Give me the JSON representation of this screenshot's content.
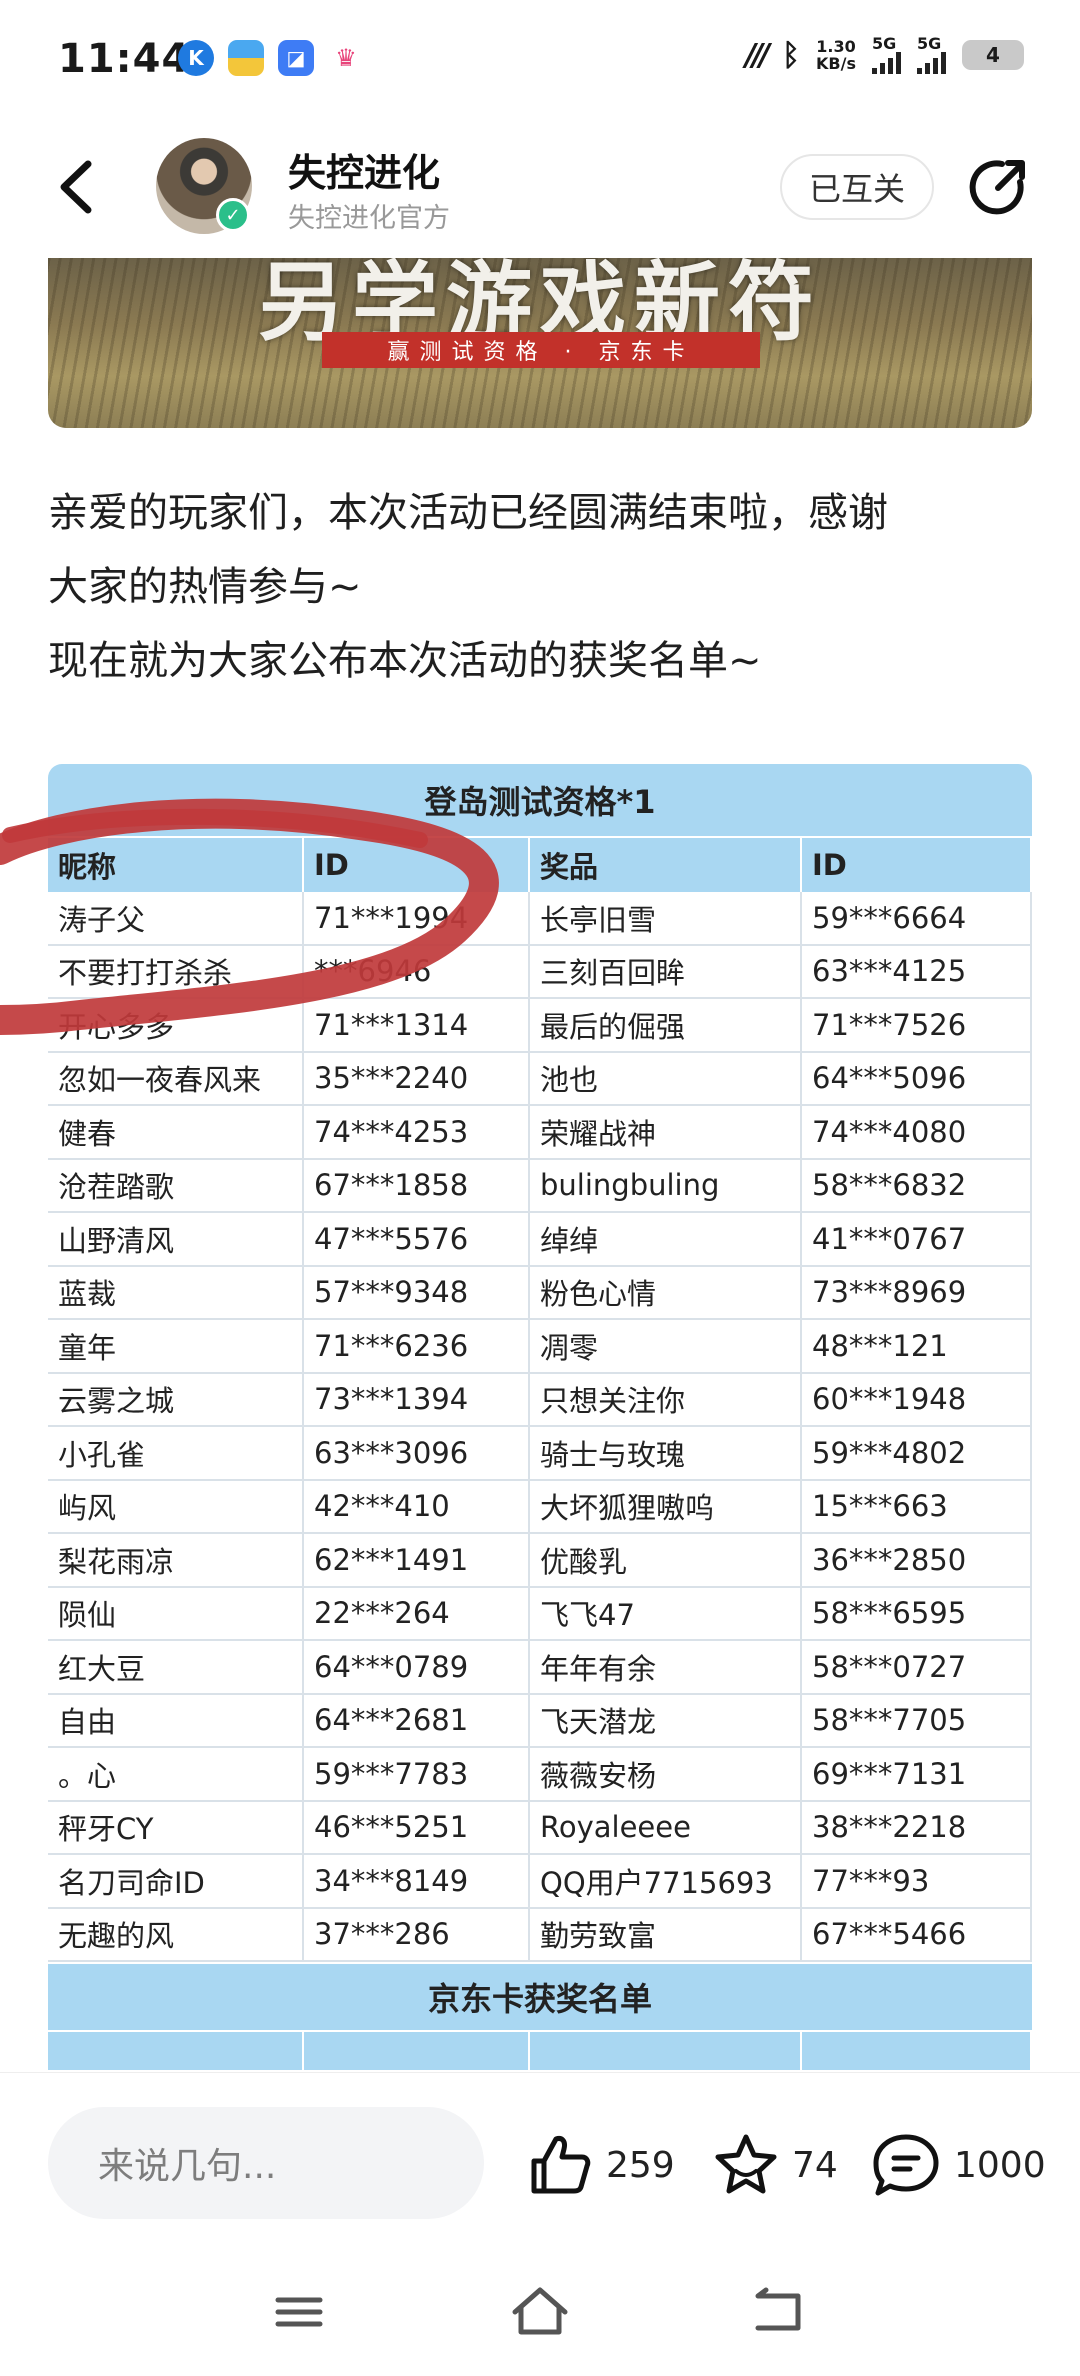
{
  "status_bar": {
    "time": "11:44",
    "net_speed_value": "1.30",
    "net_speed_unit": "KB/s",
    "sig1_label": "5G",
    "sig2_label": "5G",
    "battery": "4"
  },
  "header": {
    "account_name": "失控进化",
    "account_sub": "失控进化官方",
    "follow_label": "已互关"
  },
  "banner": {
    "title": "另学游戏新符",
    "ribbon": "赢测试资格 · 京东卡"
  },
  "post": {
    "lines": [
      "亲爱的玩家们，本次活动已经圆满结束啦，感谢",
      "大家的热情参与~",
      "现在就为大家公布本次活动的获奖名单~"
    ]
  },
  "table": {
    "title": "登岛测试资格*1",
    "headers": [
      "昵称",
      "ID",
      "奖品",
      "ID"
    ],
    "rows": [
      [
        "涛子父",
        "71***1994",
        "长亭旧雪",
        "59***6664"
      ],
      [
        "不要打打杀杀",
        "  ***6946",
        "三刻百回眸",
        "63***4125"
      ],
      [
        "开心多多",
        "71***1314",
        "最后的倔强",
        "71***7526"
      ],
      [
        "忽如一夜春风来",
        "35***2240",
        "池也",
        "64***5096"
      ],
      [
        "健春",
        "74***4253",
        "荣耀战神",
        "74***4080"
      ],
      [
        "沧茬踏歌",
        "67***1858",
        "bulingbuling",
        "58***6832"
      ],
      [
        "山野清风",
        "47***5576",
        "绰绰",
        "41***0767"
      ],
      [
        "蓝裁",
        "57***9348",
        "粉色心情",
        "73***8969"
      ],
      [
        "童年",
        "71***6236",
        "凋零",
        "48***121"
      ],
      [
        "云雾之城",
        "73***1394",
        "只想关注你",
        "60***1948"
      ],
      [
        "小孔雀",
        "63***3096",
        "骑士与玫瑰",
        "59***4802"
      ],
      [
        "屿风",
        "42***410",
        "大坏狐狸嗷呜",
        "15***663"
      ],
      [
        "梨花雨凉",
        "62***1491",
        "优酸乳",
        "36***2850"
      ],
      [
        "陨仙",
        "22***264",
        "飞飞47",
        "58***6595"
      ],
      [
        "红大豆",
        "64***0789",
        "年年有余",
        "58***0727"
      ],
      [
        "自由",
        "64***2681",
        "飞天潜龙",
        "58***7705"
      ],
      [
        "。心",
        "59***7783",
        "薇薇安杨",
        "69***7131"
      ],
      [
        "秤牙CY",
        "46***5251",
        "Royaleeee",
        "38***2218"
      ],
      [
        "名刀司命ID",
        "34***8149",
        "QQ用户7715693",
        "77***93"
      ],
      [
        "无趣的风",
        "37***286",
        "勤劳致富",
        "67***5466"
      ]
    ],
    "title2": "京东卡获奖名单"
  },
  "bottom": {
    "comment_placeholder": "来说几句...",
    "likes": "259",
    "favorites": "74",
    "comments": "1000"
  },
  "colors": {
    "table_header_bg": "#a9d7f2",
    "scribble": "#c0393b",
    "banner_ribbon": "#c2312a"
  }
}
